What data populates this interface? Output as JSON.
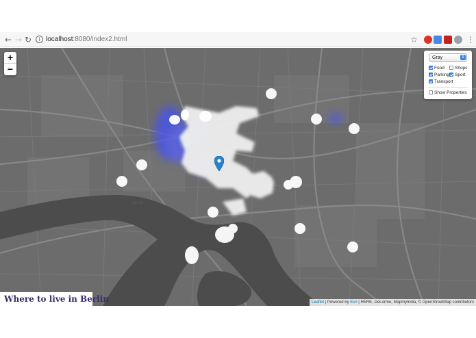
{
  "browser": {
    "back_icon": "arrow-left-icon",
    "forward_icon": "arrow-right-icon",
    "reload_icon": "reload-icon",
    "url_host": "localhost",
    "url_rest": ":8080/index2.html",
    "bookmark_icon": "star-icon",
    "extensions": [
      {
        "name": "opera-extension-icon",
        "color": "#d9342b"
      },
      {
        "name": "translate-extension-icon",
        "color": "#4a86e8"
      },
      {
        "name": "mail-extension-icon",
        "color": "#c5221f"
      },
      {
        "name": "puzzle-extension-icon",
        "color": "#9aa0a6"
      }
    ],
    "menu_icon": "more-vertical-icon"
  },
  "map": {
    "zoom_in_label": "+",
    "zoom_out_label": "−",
    "title": "Where to live in Berlin",
    "layers": {
      "basemap": "Gray",
      "options": [
        {
          "label": "Food",
          "checked": true
        },
        {
          "label": "Shops",
          "checked": false
        },
        {
          "label": "Parking",
          "checked": true
        },
        {
          "label": "Sport",
          "checked": true
        },
        {
          "label": "Transport",
          "checked": true
        }
      ],
      "show_properties": {
        "label": "Show Properties",
        "checked": false
      }
    },
    "marker_icon": "map-pin-icon",
    "attribution": {
      "leaflet": "Leaflet",
      "sep1": " | Powered by ",
      "esri": "Esri",
      "rest": " | HERE, DeLorme, MapmyIndia, © OpenStreetMap contributors"
    },
    "colors": {
      "base": "#6b6b6b",
      "water": "#4a4a4a",
      "roads": "#8a8a8a",
      "heat": "#ffffff",
      "heat_blue": "#5560e8",
      "marker": "#2a81cb"
    }
  }
}
